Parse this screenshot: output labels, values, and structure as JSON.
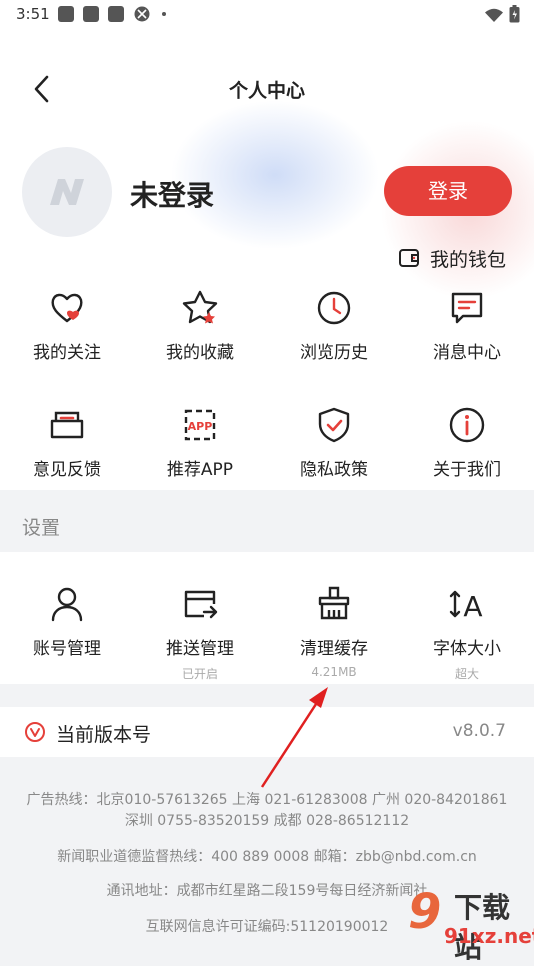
{
  "status_bar": {
    "time": "3:51"
  },
  "header": {
    "title": "个人中心"
  },
  "profile": {
    "username": "未登录",
    "login_button": "登录",
    "wallet_label": "我的钱包"
  },
  "grid": [
    {
      "label": "我的关注",
      "icon": "heart-icon"
    },
    {
      "label": "我的收藏",
      "icon": "star-icon"
    },
    {
      "label": "浏览历史",
      "icon": "clock-icon"
    },
    {
      "label": "消息中心",
      "icon": "message-icon"
    },
    {
      "label": "意见反馈",
      "icon": "feedback-icon"
    },
    {
      "label": "推荐APP",
      "icon": "app-icon",
      "icon_text": "APP"
    },
    {
      "label": "隐私政策",
      "icon": "shield-icon"
    },
    {
      "label": "关于我们",
      "icon": "info-icon"
    }
  ],
  "settings": {
    "section_title": "设置",
    "items": [
      {
        "label": "账号管理",
        "sub": "",
        "icon": "user-icon"
      },
      {
        "label": "推送管理",
        "sub": "已开启",
        "icon": "push-icon"
      },
      {
        "label": "清理缓存",
        "sub": "4.21MB",
        "icon": "broom-icon"
      },
      {
        "label": "字体大小",
        "sub": "超大",
        "icon": "font-size-icon",
        "icon_text": "A"
      }
    ]
  },
  "version": {
    "label": "当前版本号",
    "value": "v8.0.7"
  },
  "footer": {
    "line1": "广告热线：北京010-57613265 上海 021-61283008 广州 020-84201861",
    "line2": "深圳 0755-83520159 成都 028-86512112",
    "line3": "新闻职业道德监督热线：400 889 0008    邮箱：zbb@nbd.com.cn",
    "line4": "通讯地址：成都市红星路二段159号每日经济新闻社",
    "line5": "互联网信息许可证编码:51120190012"
  },
  "watermark": {
    "num": "9",
    "text": "下载站",
    "domain": "91xz.net"
  },
  "colors": {
    "accent": "#e5403a",
    "background": "#f2f3f5",
    "text": "#222222",
    "muted": "#888888"
  }
}
